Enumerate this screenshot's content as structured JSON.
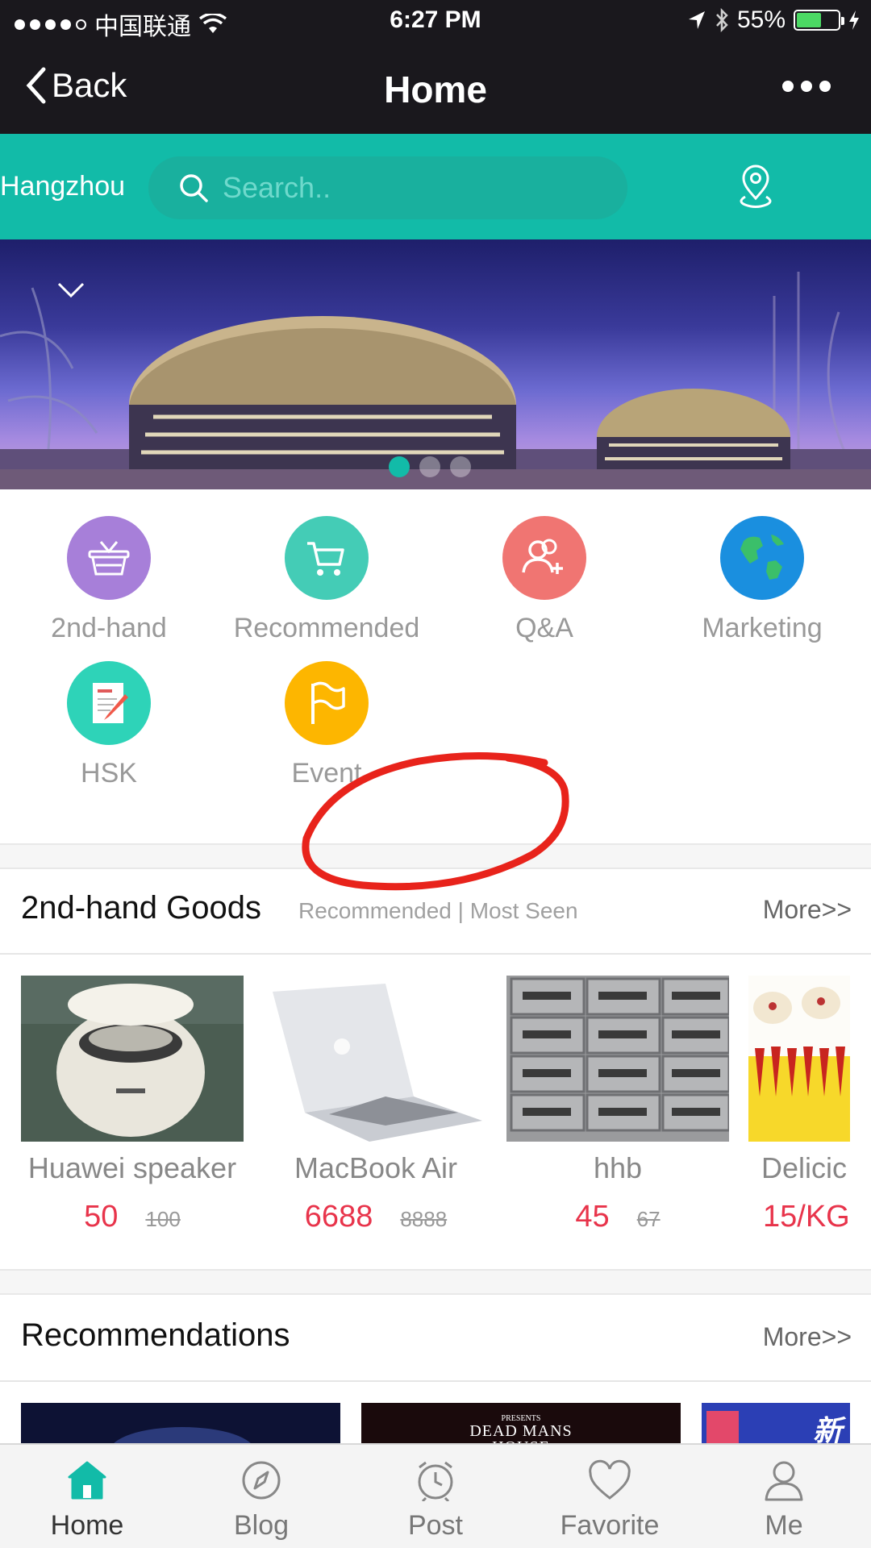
{
  "status_bar": {
    "carrier": "中国联通",
    "time": "6:27 PM",
    "battery": "55%",
    "battery_level": 0.55
  },
  "navbar": {
    "back_label": "Back",
    "title": "Home"
  },
  "search": {
    "city": "Hangzhou",
    "placeholder": "Search.."
  },
  "banner": {
    "pages": 3,
    "active_page": 1
  },
  "categories": [
    {
      "label": "2nd-hand",
      "color": "#a77fd9",
      "icon": "basket-icon"
    },
    {
      "label": "Recommended",
      "color": "#44ccb6",
      "icon": "cart-icon"
    },
    {
      "label": "Q&A",
      "color": "#f07572",
      "icon": "add-user-icon"
    },
    {
      "label": "Marketing",
      "color": "#1a8fdf",
      "icon": "globe-icon"
    },
    {
      "label": "HSK",
      "color": "#2ed3b8",
      "icon": "document-icon"
    },
    {
      "label": "Event",
      "color": "#fdb600",
      "icon": "flag-icon"
    }
  ],
  "secondhand": {
    "title": "2nd-hand Goods",
    "subtitle": "Recommended | Most Seen",
    "more": "More>>",
    "items": [
      {
        "name": "Huawei speaker",
        "price": "50",
        "old_price": "100"
      },
      {
        "name": "MacBook Air",
        "price": "6688",
        "old_price": "8888"
      },
      {
        "name": "hhb",
        "price": "45",
        "old_price": "67"
      },
      {
        "name": "Delicic",
        "price": "15/KG",
        "old_price": ""
      }
    ]
  },
  "recommendations": {
    "title": "Recommendations",
    "more": "More>>",
    "thumb_text": [
      "PRESENTS",
      "DEAD MANS",
      "HOUSE",
      "新"
    ]
  },
  "tabs": [
    {
      "label": "Home",
      "icon": "home-icon",
      "active": true
    },
    {
      "label": "Blog",
      "icon": "compass-icon",
      "active": false
    },
    {
      "label": "Post",
      "icon": "alarm-clock-icon",
      "active": false
    },
    {
      "label": "Favorite",
      "icon": "heart-icon",
      "active": false
    },
    {
      "label": "Me",
      "icon": "person-icon",
      "active": false
    }
  ],
  "colors": {
    "teal": "#12bba8",
    "price_red": "#e8344b",
    "dark_bar": "#1a181d"
  }
}
